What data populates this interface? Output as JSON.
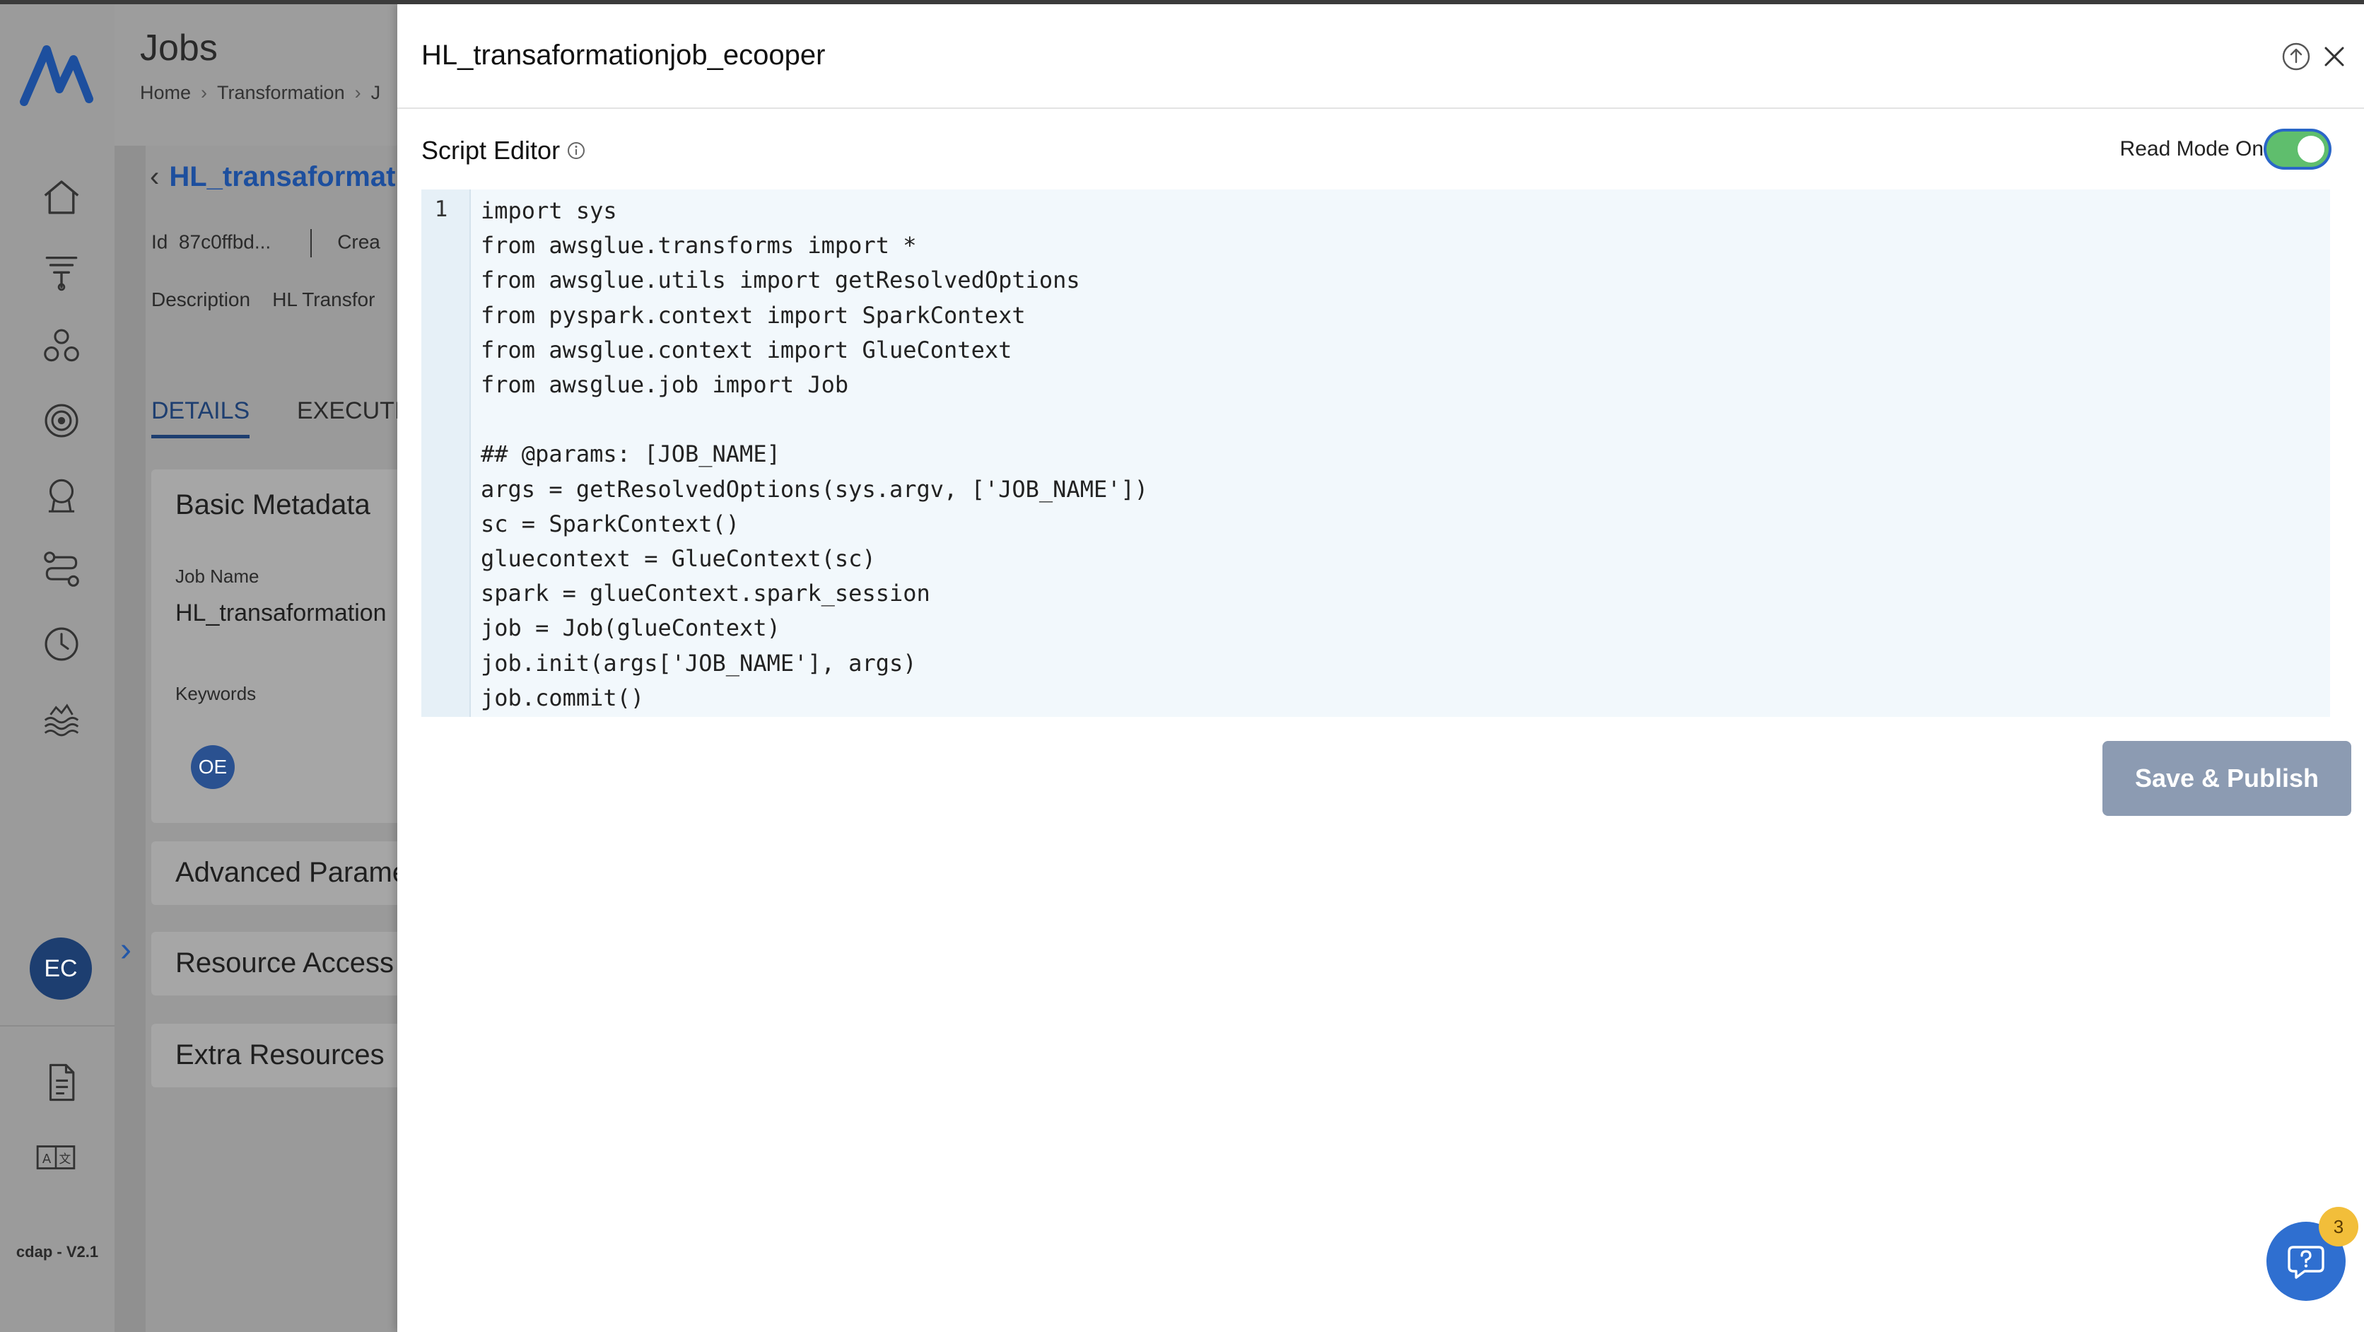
{
  "app": {
    "version": "cdap - V2.1",
    "user_initials": "EC",
    "colors": {
      "brand": "#1d4f9e",
      "toggle_on": "#5fbe6d",
      "primary_disabled": "#8c9bb2",
      "badge": "#f2be3a"
    }
  },
  "sidebar": {
    "icons": [
      "logo-icon",
      "home-icon",
      "funnel-icon",
      "cluster-icon",
      "target-icon",
      "certificate-icon",
      "workflow-icon",
      "clock-icon",
      "data-lake-icon",
      "document-icon",
      "translate-icon"
    ]
  },
  "page": {
    "title": "Jobs",
    "breadcrumb": [
      "Home",
      "Transformation",
      "J"
    ],
    "job_link": "HL_transaformatio",
    "id_label": "Id",
    "id_value": "87c0ffbd...",
    "created_truncated": "Crea",
    "description_label": "Description",
    "description_value": "HL Transfor",
    "tabs": [
      {
        "label": "DETAILS",
        "active": true
      },
      {
        "label": "EXECUTI",
        "active": false
      }
    ],
    "basic_metadata": {
      "title": "Basic Metadata",
      "job_name_label": "Job Name",
      "job_name_value": "HL_transaformation",
      "keywords_label": "Keywords",
      "keyword_chip": "OE"
    },
    "sections": [
      "Advanced Parame",
      "Resource Access",
      "Extra Resources"
    ]
  },
  "drawer": {
    "title": "HL_transaformationjob_ecooper",
    "section_label": "Script Editor",
    "read_mode_label": "Read Mode On",
    "read_mode_on": true,
    "editor": {
      "line_numbers": [
        "1"
      ],
      "code": "import sys\nfrom awsglue.transforms import *\nfrom awsglue.utils import getResolvedOptions\nfrom pyspark.context import SparkContext\nfrom awsglue.context import GlueContext\nfrom awsglue.job import Job\n\n## @params: [JOB_NAME]\nargs = getResolvedOptions(sys.argv, ['JOB_NAME'])\nsc = SparkContext()\ngluecontext = GlueContext(sc)\nspark = glueContext.spark_session\njob = Job(glueContext)\njob.init(args['JOB_NAME'], args)\njob.commit()"
    },
    "save_label": "Save & Publish"
  },
  "help": {
    "badge_count": "3"
  }
}
